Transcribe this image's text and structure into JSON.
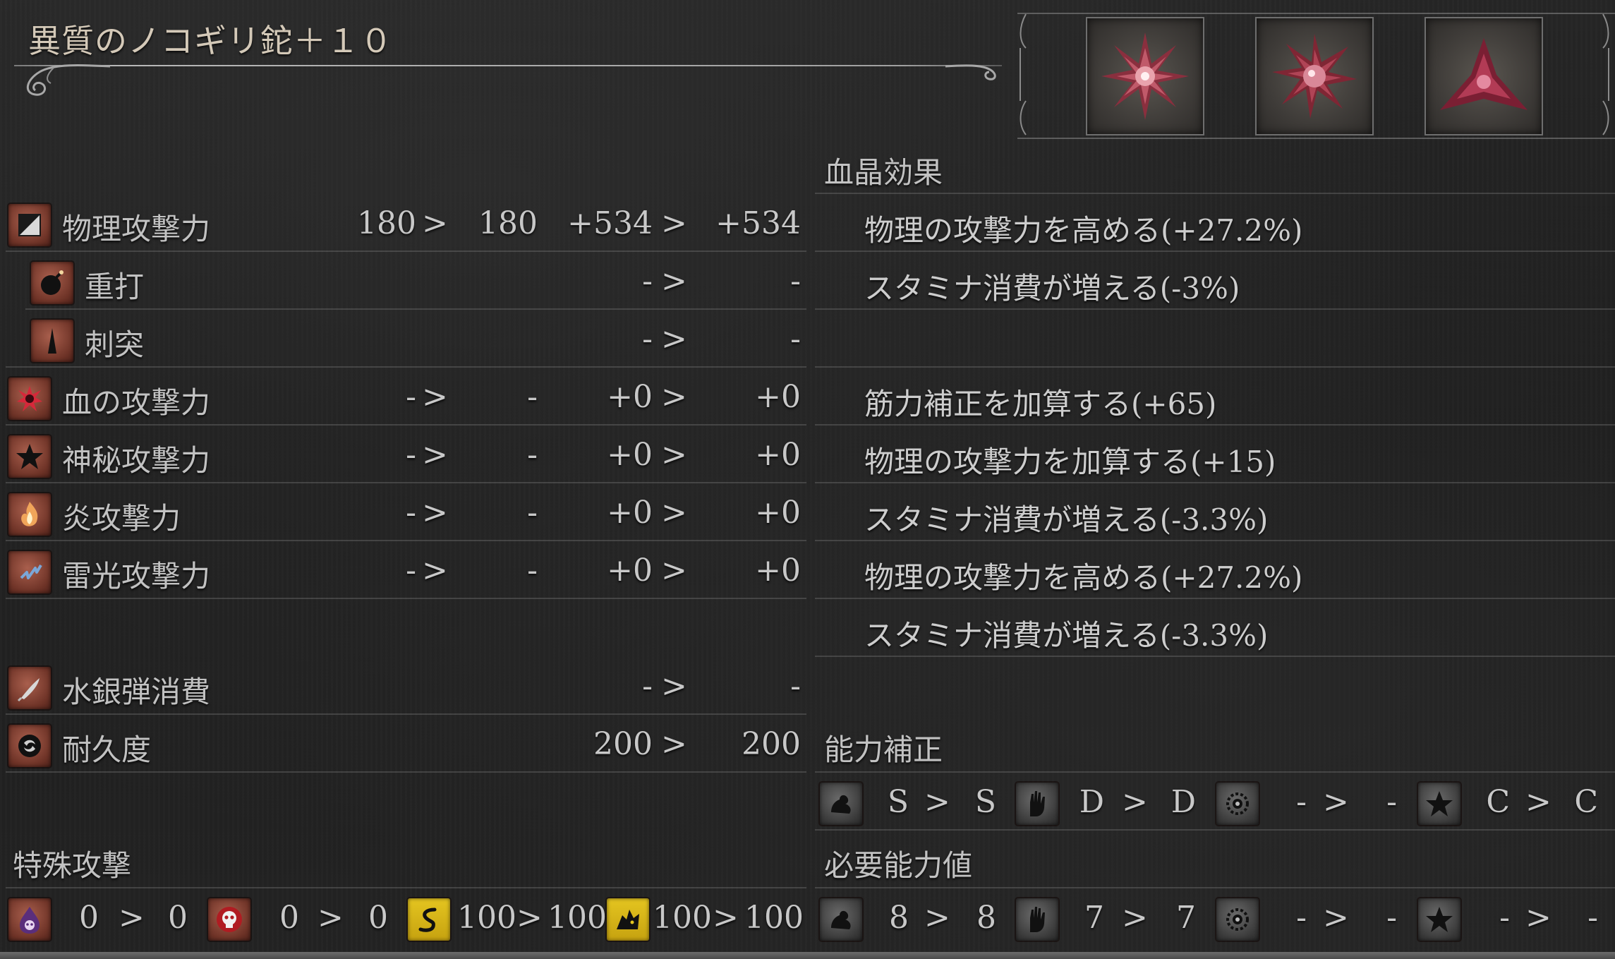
{
  "weapon": {
    "name": "異質のノコギリ鉈＋１０"
  },
  "blood_gems": {
    "slots": [
      {
        "icon": "radial-blood-gem-icon"
      },
      {
        "icon": "radial-blood-gem-icon"
      },
      {
        "icon": "triangle-blood-gem-icon"
      }
    ]
  },
  "attack": {
    "arrow": ">",
    "physical": {
      "label": "物理攻撃力",
      "icon": "physical-attack-icon",
      "base_current": "180",
      "base_new": "180",
      "bonus_current": "+534",
      "bonus_new": "+534"
    },
    "blunt": {
      "label": "重打",
      "icon": "blunt-bomb-icon",
      "current": "-",
      "new": "-"
    },
    "thrust": {
      "label": "刺突",
      "icon": "thrust-spike-icon",
      "current": "-",
      "new": "-"
    },
    "blood": {
      "label": "血の攻撃力",
      "icon": "blood-attack-icon",
      "base_current": "-",
      "base_new": "-",
      "bonus_current": "+0",
      "bonus_new": "+0"
    },
    "arcane": {
      "label": "神秘攻撃力",
      "icon": "arcane-star-icon",
      "base_current": "-",
      "base_new": "-",
      "bonus_current": "+0",
      "bonus_new": "+0"
    },
    "fire": {
      "label": "炎攻撃力",
      "icon": "fire-attack-icon",
      "base_current": "-",
      "base_new": "-",
      "bonus_current": "+0",
      "bonus_new": "+0"
    },
    "bolt": {
      "label": "雷光攻撃力",
      "icon": "bolt-attack-icon",
      "base_current": "-",
      "base_new": "-",
      "bonus_current": "+0",
      "bonus_new": "+0"
    },
    "bullet_use": {
      "label": "水銀弾消費",
      "icon": "quicksilver-bullet-icon",
      "current": "-",
      "new": "-"
    },
    "durability": {
      "label": "耐久度",
      "icon": "durability-icon",
      "current": "200",
      "new": "200"
    }
  },
  "gem_effects": {
    "header": "血晶効果",
    "items": [
      "物理の攻撃力を高める(+27.2%)",
      "スタミナ消費が増える(-3%)",
      "",
      "筋力補正を加算する(+65)",
      "物理の攻撃力を加算する(+15)",
      "スタミナ消費が増える(-3.3%)",
      "物理の攻撃力を高める(+27.2%)",
      "スタミナ消費が増える(-3.3%)"
    ]
  },
  "scaling": {
    "header": "能力補正",
    "items": [
      {
        "icon": "strength-arm-icon",
        "current": "S",
        "new": "S"
      },
      {
        "icon": "skill-hand-icon",
        "current": "D",
        "new": "D"
      },
      {
        "icon": "bloodtinge-eye-icon",
        "current": "-",
        "new": "-"
      },
      {
        "icon": "arcane-star-icon",
        "current": "C",
        "new": "C"
      }
    ]
  },
  "requirements": {
    "header": "必要能力値",
    "items": [
      {
        "icon": "strength-arm-icon",
        "current": "8",
        "new": "8"
      },
      {
        "icon": "skill-hand-icon",
        "current": "7",
        "new": "7"
      },
      {
        "icon": "bloodtinge-eye-icon",
        "current": "-",
        "new": "-"
      },
      {
        "icon": "arcane-star-icon",
        "current": "-",
        "new": "-"
      }
    ]
  },
  "special_attack": {
    "header": "特殊攻撃",
    "items": [
      {
        "icon": "slow-poison-icon",
        "current": "0",
        "new": "0"
      },
      {
        "icon": "rapid-poison-skull-icon",
        "current": "0",
        "new": "0"
      },
      {
        "icon": "serrated-icon",
        "current": "100",
        "new": "100"
      },
      {
        "icon": "righteous-beast-icon",
        "current": "100",
        "new": "100"
      }
    ]
  },
  "colors": {
    "text": "#c9c9c9",
    "title": "#d4c9b8",
    "icon_red": "#7a3a2c",
    "icon_yellow": "#d9b81a",
    "background": "#222222"
  }
}
